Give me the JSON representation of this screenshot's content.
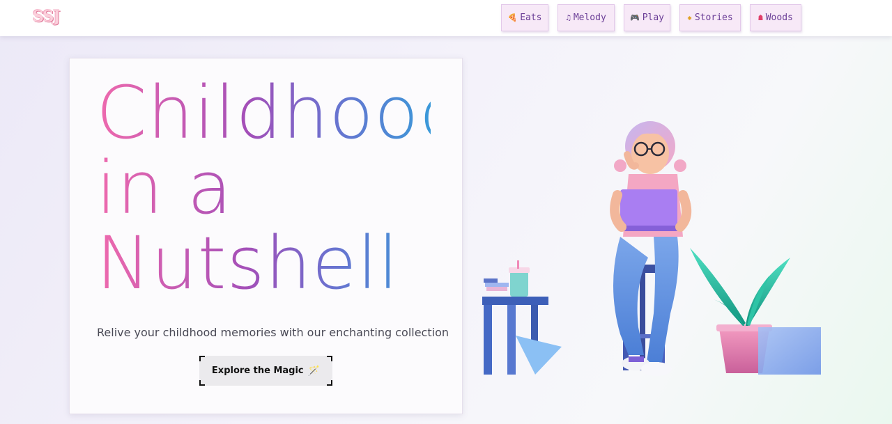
{
  "logo": {
    "text": "SSJ"
  },
  "nav": [
    {
      "label": "Eats",
      "icon": "pizza-icon",
      "glyph": "🍕"
    },
    {
      "label": "Melody",
      "icon": "music-note-icon",
      "glyph": "♫"
    },
    {
      "label": "Play",
      "icon": "gamepad-icon",
      "glyph": "🎮"
    },
    {
      "label": "Stories",
      "icon": "sparkle-icon",
      "glyph": "✸"
    },
    {
      "label": "Woods",
      "icon": "backpack-icon",
      "glyph": "☗"
    }
  ],
  "hero": {
    "title_lines": [
      "Childhood",
      "in a",
      "Nutshell"
    ],
    "subtitle": "Relive your childhood memories with our enchanting collection",
    "cta_label": "Explore the Magic",
    "cta_icon": "magic-wand-icon",
    "cta_glyph": "🪄"
  },
  "illustration": {
    "name": "girl-with-laptop-illustration"
  },
  "colors": {
    "title_gradient": [
      "#ef6aad",
      "#a44fb8",
      "#6b71cf",
      "#3a99d9"
    ],
    "nav_bg": "#f7e9f7",
    "nav_text": "#6a3d96"
  }
}
